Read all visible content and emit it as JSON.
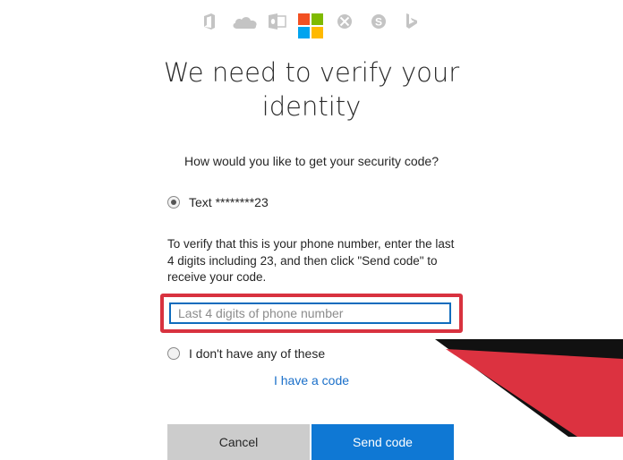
{
  "header": {
    "icons": [
      "office-icon",
      "onedrive-icon",
      "outlook-icon",
      "microsoft-logo",
      "xbox-icon",
      "skype-icon",
      "bing-icon"
    ]
  },
  "colors": {
    "ms_red": "#f25022",
    "ms_green": "#7fba00",
    "ms_blue": "#00a4ef",
    "ms_yellow": "#ffb900",
    "highlight": "#d8323f",
    "accent": "#0f78d4",
    "link": "#1a6fc9"
  },
  "page": {
    "title_line1": "We need to verify your",
    "title_line2": "identity",
    "question": "How would you like to get your security code?"
  },
  "options": {
    "text_option": "Text ********23",
    "none_option": "I don't have any of these"
  },
  "instructions": "To verify that this is your phone number, enter the last 4 digits including 23, and then click \"Send code\" to receive your code.",
  "phone_input": {
    "placeholder": "Last 4 digits of phone number",
    "value": ""
  },
  "links": {
    "have_code": "I have a code"
  },
  "buttons": {
    "cancel": "Cancel",
    "send": "Send code"
  }
}
